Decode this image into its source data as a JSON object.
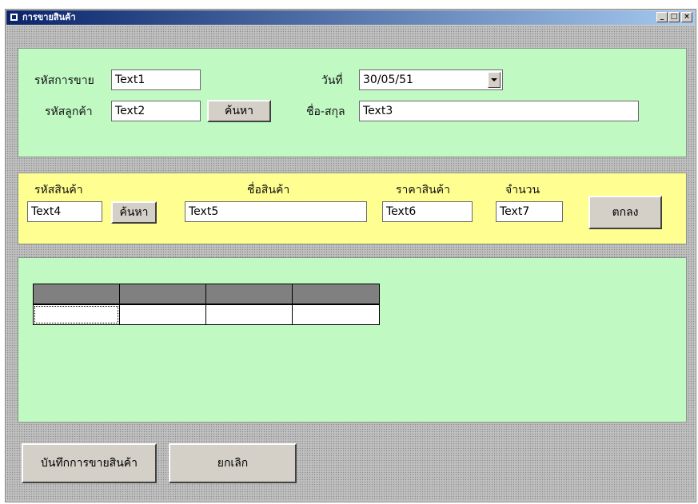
{
  "window": {
    "title": "การขายสินค้า",
    "controls": {
      "minimize": "_",
      "maximize": "□",
      "close": "×"
    }
  },
  "header": {
    "sale_id_label": "รหัสการขาย",
    "sale_id_value": "Text1",
    "date_label": "วันที่",
    "date_value": "30/05/51",
    "customer_id_label": "รหัสลูกค้า",
    "customer_id_value": "Text2",
    "customer_search_label": "ค้นหา",
    "name_label": "ชื่อ-สกุล",
    "name_value": "Text3"
  },
  "product": {
    "product_id_label": "รหัสสินค้า",
    "product_id_value": "Text4",
    "product_search_label": "ค้นหา",
    "product_name_label": "ชื่อสินค้า",
    "product_name_value": "Text5",
    "price_label": "ราคาสินค้า",
    "price_value": "Text6",
    "qty_label": "จำนวน",
    "qty_value": "Text7",
    "ok_label": "ตกลง"
  },
  "footer": {
    "save_label": "บันทึกการขายสินค้า",
    "cancel_label": "ยกเลิก"
  },
  "colors": {
    "green_panel": "#c1f9c3",
    "yellow_panel": "#fffe91",
    "title_start": "#0a246a",
    "title_end": "#a6caf0"
  }
}
